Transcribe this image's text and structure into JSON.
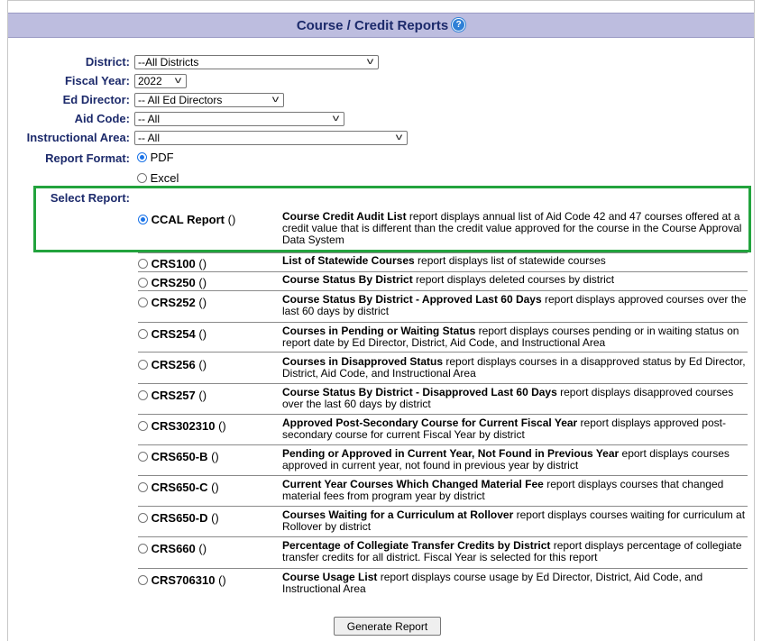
{
  "header": {
    "title": "Course / Credit Reports",
    "help_icon": "?"
  },
  "filters": {
    "district": {
      "label": "District:",
      "value": "--All Districts"
    },
    "fiscal_year": {
      "label": "Fiscal Year:",
      "value": "2022"
    },
    "ed_director": {
      "label": "Ed Director:",
      "value": "-- All Ed Directors"
    },
    "aid_code": {
      "label": "Aid Code:",
      "value": "-- All"
    },
    "instructional_area": {
      "label": "Instructional Area:",
      "value": "-- All"
    }
  },
  "report_format": {
    "label": "Report Format:",
    "options": [
      {
        "label": "PDF",
        "selected": true
      },
      {
        "label": "Excel",
        "selected": false
      }
    ]
  },
  "select_report": {
    "label": "Select Report:",
    "reports": [
      {
        "name": "CCAL Report",
        "paren": " ()",
        "title": "Course Credit Audit List",
        "desc": " report displays annual list of Aid Code 42 and 47 courses offered at a credit value that is different than the credit value approved for the course in the Course Approval Data System",
        "selected": true
      },
      {
        "name": "CRS100",
        "paren": " ()",
        "title": "List of Statewide Courses",
        "desc": " report displays list of statewide courses",
        "selected": false
      },
      {
        "name": "CRS250",
        "paren": " ()",
        "title": "Course Status By District",
        "desc": " report displays deleted courses by district",
        "selected": false
      },
      {
        "name": "CRS252",
        "paren": " ()",
        "title": "Course Status By District - Approved Last 60 Days",
        "desc": " report displays approved courses over the last 60 days by district",
        "selected": false
      },
      {
        "name": "CRS254",
        "paren": " ()",
        "title": "Courses in Pending or Waiting Status",
        "desc": " report displays courses pending or in waiting status on report date by Ed Director, District, Aid Code, and Instructional Area",
        "selected": false
      },
      {
        "name": "CRS256",
        "paren": " ()",
        "title": "Courses in Disapproved Status",
        "desc": " report displays courses in a disapproved status by Ed Director, District, Aid Code, and Instructional Area",
        "selected": false
      },
      {
        "name": "CRS257",
        "paren": " ()",
        "title": "Course Status By District - Disapproved Last 60 Days",
        "desc": " report displays disapproved courses over the last 60 days by district",
        "selected": false
      },
      {
        "name": "CRS302310",
        "paren": " ()",
        "title": "Approved Post-Secondary Course for Current Fiscal Year",
        "desc": " report displays approved post-secondary course for current Fiscal Year by district",
        "selected": false
      },
      {
        "name": "CRS650-B",
        "paren": " ()",
        "title": "Pending or Approved in Current Year, Not Found in Previous Year",
        "desc": " eport displays courses approved in current year, not found in previous year by district",
        "selected": false
      },
      {
        "name": "CRS650-C",
        "paren": " ()",
        "title": "Current Year Courses Which Changed Material Fee",
        "desc": " report displays courses that changed material fees from program year by district",
        "selected": false
      },
      {
        "name": "CRS650-D",
        "paren": " ()",
        "title": "Courses Waiting for a Curriculum at Rollover",
        "desc": " report displays courses waiting for curriculum at Rollover by district",
        "selected": false
      },
      {
        "name": "CRS660",
        "paren": " ()",
        "title": "Percentage of Collegiate Transfer Credits by District",
        "desc": " report displays percentage of collegiate transfer credits for all district. Fiscal Year is selected for this report",
        "selected": false
      },
      {
        "name": "CRS706310",
        "paren": " ()",
        "title": "Course Usage List",
        "desc": " report displays course usage by Ed Director, District, Aid Code, and Instructional Area",
        "selected": false
      }
    ]
  },
  "actions": {
    "generate_label": "Generate Report"
  },
  "colors": {
    "header_bg": "#bdbddf",
    "label_text": "#1c2a6b",
    "highlight_border": "#22a33d",
    "radio_selected": "#1a73e8"
  }
}
